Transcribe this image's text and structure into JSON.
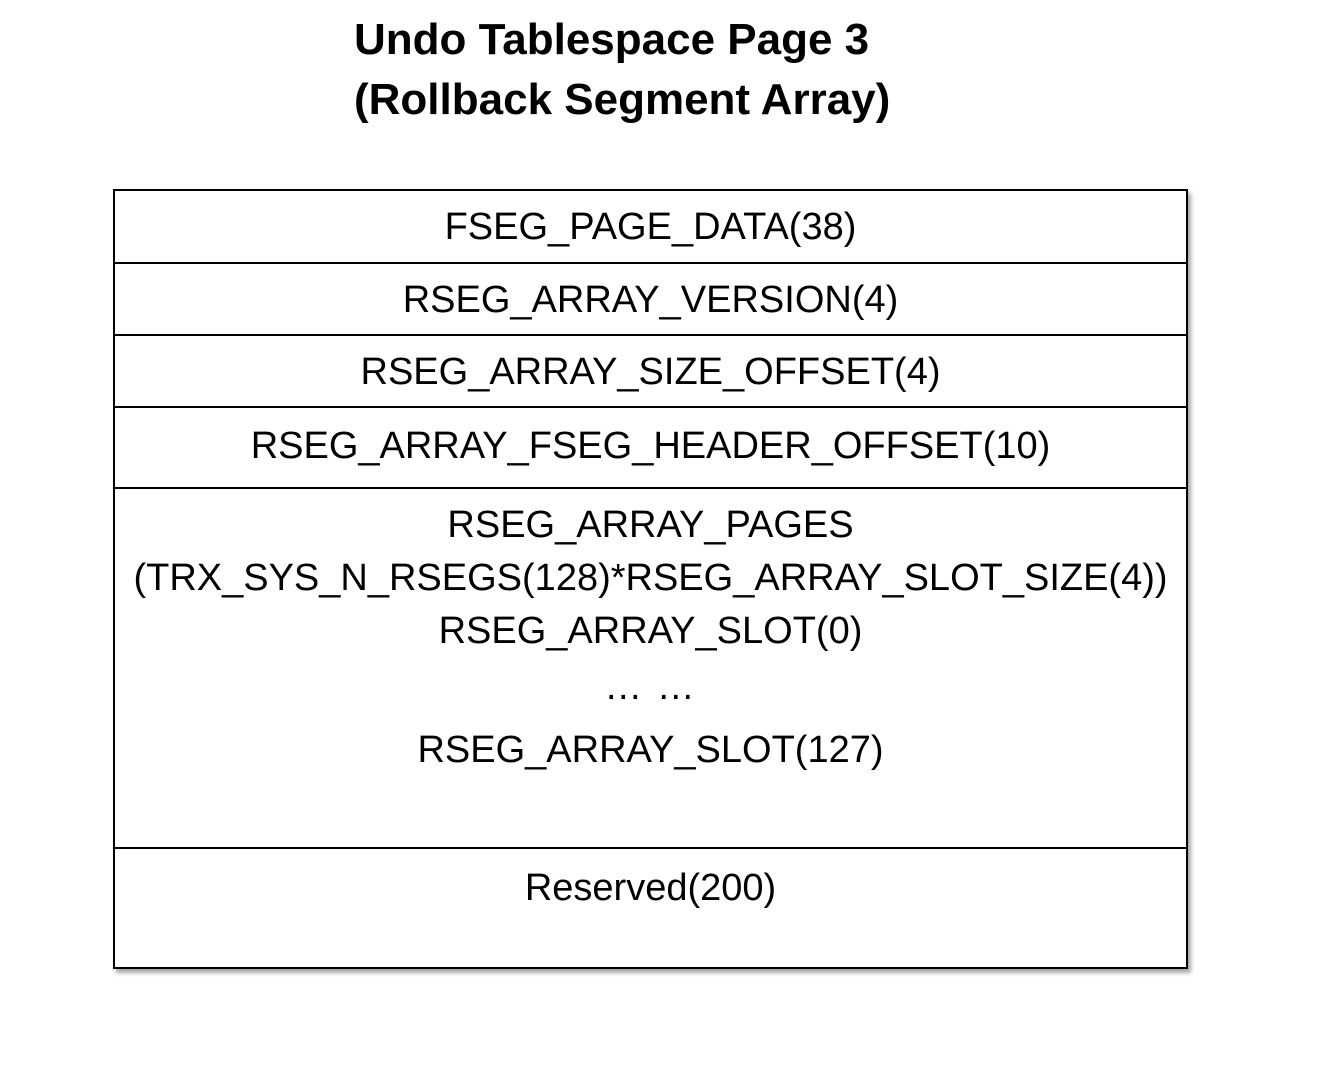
{
  "title": {
    "line1": "Undo Tablespace Page 3",
    "line2": "(Rollback Segment Array)"
  },
  "rows": [
    {
      "label": "FSEG_PAGE_DATA(38)"
    },
    {
      "label": "RSEG_ARRAY_VERSION(4)"
    },
    {
      "label": "RSEG_ARRAY_SIZE_OFFSET(4)"
    },
    {
      "label": "RSEG_ARRAY_FSEG_HEADER_OFFSET(10)"
    },
    {
      "lines": [
        "RSEG_ARRAY_PAGES",
        "(TRX_SYS_N_RSEGS(128)*RSEG_ARRAY_SLOT_SIZE(4))",
        "RSEG_ARRAY_SLOT(0)",
        "… …",
        "RSEG_ARRAY_SLOT(127)"
      ]
    },
    {
      "label": "Reserved(200)"
    }
  ]
}
